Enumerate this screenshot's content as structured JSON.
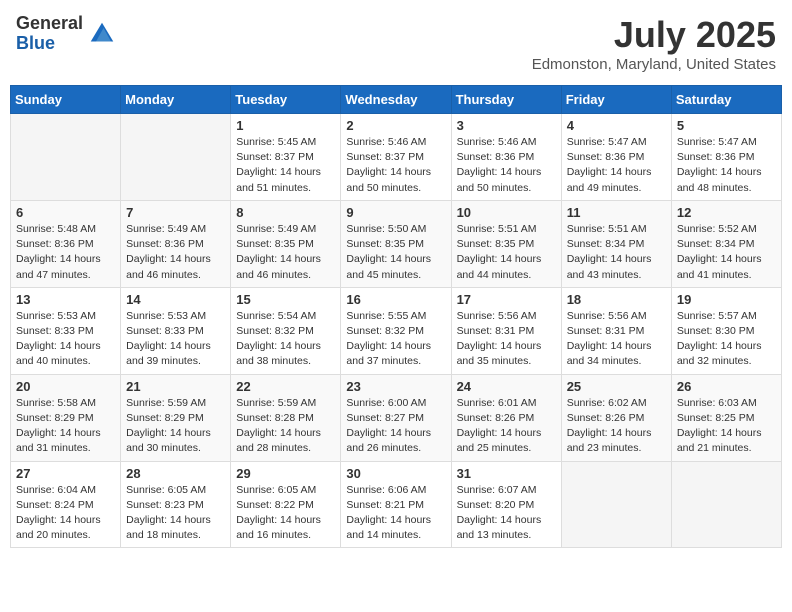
{
  "header": {
    "logo_general": "General",
    "logo_blue": "Blue",
    "month_title": "July 2025",
    "location": "Edmonston, Maryland, United States"
  },
  "weekdays": [
    "Sunday",
    "Monday",
    "Tuesday",
    "Wednesday",
    "Thursday",
    "Friday",
    "Saturday"
  ],
  "weeks": [
    [
      {
        "day": "",
        "empty": true
      },
      {
        "day": "",
        "empty": true
      },
      {
        "day": "1",
        "sunrise": "5:45 AM",
        "sunset": "8:37 PM",
        "daylight": "14 hours and 51 minutes."
      },
      {
        "day": "2",
        "sunrise": "5:46 AM",
        "sunset": "8:37 PM",
        "daylight": "14 hours and 50 minutes."
      },
      {
        "day": "3",
        "sunrise": "5:46 AM",
        "sunset": "8:36 PM",
        "daylight": "14 hours and 50 minutes."
      },
      {
        "day": "4",
        "sunrise": "5:47 AM",
        "sunset": "8:36 PM",
        "daylight": "14 hours and 49 minutes."
      },
      {
        "day": "5",
        "sunrise": "5:47 AM",
        "sunset": "8:36 PM",
        "daylight": "14 hours and 48 minutes."
      }
    ],
    [
      {
        "day": "6",
        "sunrise": "5:48 AM",
        "sunset": "8:36 PM",
        "daylight": "14 hours and 47 minutes."
      },
      {
        "day": "7",
        "sunrise": "5:49 AM",
        "sunset": "8:36 PM",
        "daylight": "14 hours and 46 minutes."
      },
      {
        "day": "8",
        "sunrise": "5:49 AM",
        "sunset": "8:35 PM",
        "daylight": "14 hours and 46 minutes."
      },
      {
        "day": "9",
        "sunrise": "5:50 AM",
        "sunset": "8:35 PM",
        "daylight": "14 hours and 45 minutes."
      },
      {
        "day": "10",
        "sunrise": "5:51 AM",
        "sunset": "8:35 PM",
        "daylight": "14 hours and 44 minutes."
      },
      {
        "day": "11",
        "sunrise": "5:51 AM",
        "sunset": "8:34 PM",
        "daylight": "14 hours and 43 minutes."
      },
      {
        "day": "12",
        "sunrise": "5:52 AM",
        "sunset": "8:34 PM",
        "daylight": "14 hours and 41 minutes."
      }
    ],
    [
      {
        "day": "13",
        "sunrise": "5:53 AM",
        "sunset": "8:33 PM",
        "daylight": "14 hours and 40 minutes."
      },
      {
        "day": "14",
        "sunrise": "5:53 AM",
        "sunset": "8:33 PM",
        "daylight": "14 hours and 39 minutes."
      },
      {
        "day": "15",
        "sunrise": "5:54 AM",
        "sunset": "8:32 PM",
        "daylight": "14 hours and 38 minutes."
      },
      {
        "day": "16",
        "sunrise": "5:55 AM",
        "sunset": "8:32 PM",
        "daylight": "14 hours and 37 minutes."
      },
      {
        "day": "17",
        "sunrise": "5:56 AM",
        "sunset": "8:31 PM",
        "daylight": "14 hours and 35 minutes."
      },
      {
        "day": "18",
        "sunrise": "5:56 AM",
        "sunset": "8:31 PM",
        "daylight": "14 hours and 34 minutes."
      },
      {
        "day": "19",
        "sunrise": "5:57 AM",
        "sunset": "8:30 PM",
        "daylight": "14 hours and 32 minutes."
      }
    ],
    [
      {
        "day": "20",
        "sunrise": "5:58 AM",
        "sunset": "8:29 PM",
        "daylight": "14 hours and 31 minutes."
      },
      {
        "day": "21",
        "sunrise": "5:59 AM",
        "sunset": "8:29 PM",
        "daylight": "14 hours and 30 minutes."
      },
      {
        "day": "22",
        "sunrise": "5:59 AM",
        "sunset": "8:28 PM",
        "daylight": "14 hours and 28 minutes."
      },
      {
        "day": "23",
        "sunrise": "6:00 AM",
        "sunset": "8:27 PM",
        "daylight": "14 hours and 26 minutes."
      },
      {
        "day": "24",
        "sunrise": "6:01 AM",
        "sunset": "8:26 PM",
        "daylight": "14 hours and 25 minutes."
      },
      {
        "day": "25",
        "sunrise": "6:02 AM",
        "sunset": "8:26 PM",
        "daylight": "14 hours and 23 minutes."
      },
      {
        "day": "26",
        "sunrise": "6:03 AM",
        "sunset": "8:25 PM",
        "daylight": "14 hours and 21 minutes."
      }
    ],
    [
      {
        "day": "27",
        "sunrise": "6:04 AM",
        "sunset": "8:24 PM",
        "daylight": "14 hours and 20 minutes."
      },
      {
        "day": "28",
        "sunrise": "6:05 AM",
        "sunset": "8:23 PM",
        "daylight": "14 hours and 18 minutes."
      },
      {
        "day": "29",
        "sunrise": "6:05 AM",
        "sunset": "8:22 PM",
        "daylight": "14 hours and 16 minutes."
      },
      {
        "day": "30",
        "sunrise": "6:06 AM",
        "sunset": "8:21 PM",
        "daylight": "14 hours and 14 minutes."
      },
      {
        "day": "31",
        "sunrise": "6:07 AM",
        "sunset": "8:20 PM",
        "daylight": "14 hours and 13 minutes."
      },
      {
        "day": "",
        "empty": true
      },
      {
        "day": "",
        "empty": true
      }
    ]
  ]
}
